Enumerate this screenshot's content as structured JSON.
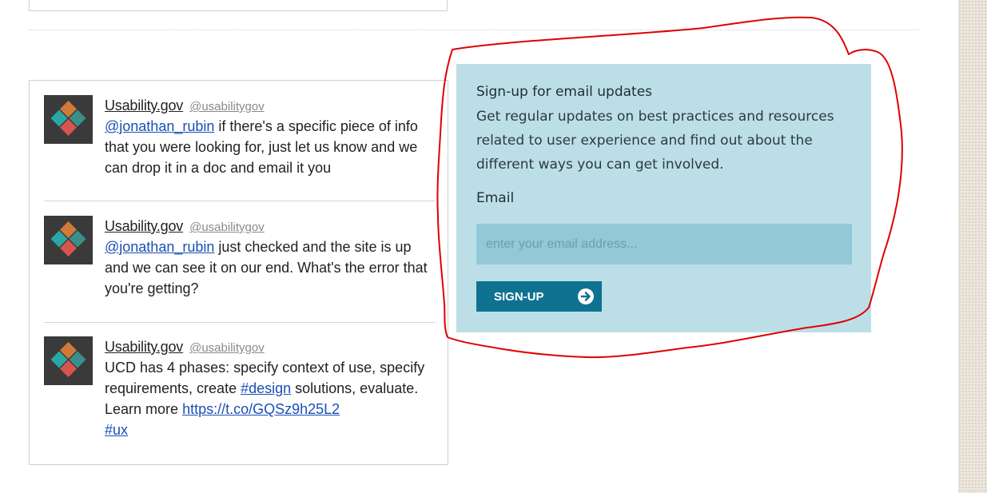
{
  "tweets": [
    {
      "name": "Usability.gov",
      "handle": "@usabilitygov",
      "mention": "@jonathan_rubin",
      "text": " if there's a specific piece of info that you were looking for, just let us know and we can drop it in a doc and email it you"
    },
    {
      "name": "Usability.gov",
      "handle": "@usabilitygov",
      "mention": "@jonathan_rubin",
      "text": " just checked and the site is up and we can see it on our end. What's the error that you're getting?"
    },
    {
      "name": "Usability.gov",
      "handle": "@usabilitygov",
      "text_before": "UCD has 4 phases: specify context of use, specify requirements, create ",
      "hashtag_design": "#design",
      "text_middle": " solutions, evaluate. Learn more ",
      "link": "https://t.co/GQSz9h25L2",
      "hashtag_ux": "#ux"
    }
  ],
  "signup": {
    "title": "Sign-up for email updates",
    "description": "Get regular updates on best practices and resources related to user experience and find out about the different ways you can get involved.",
    "email_label": "Email",
    "email_placeholder": "enter your email address...",
    "email_value": "",
    "button_label": "SIGN-UP",
    "button_icon": "arrow-right-circle-icon"
  },
  "colors": {
    "signup_background": "#bcdfe7",
    "input_background": "#93c8d7",
    "button_background": "#0f7290",
    "link": "#1a4fb5",
    "annotation": "#e00000"
  }
}
